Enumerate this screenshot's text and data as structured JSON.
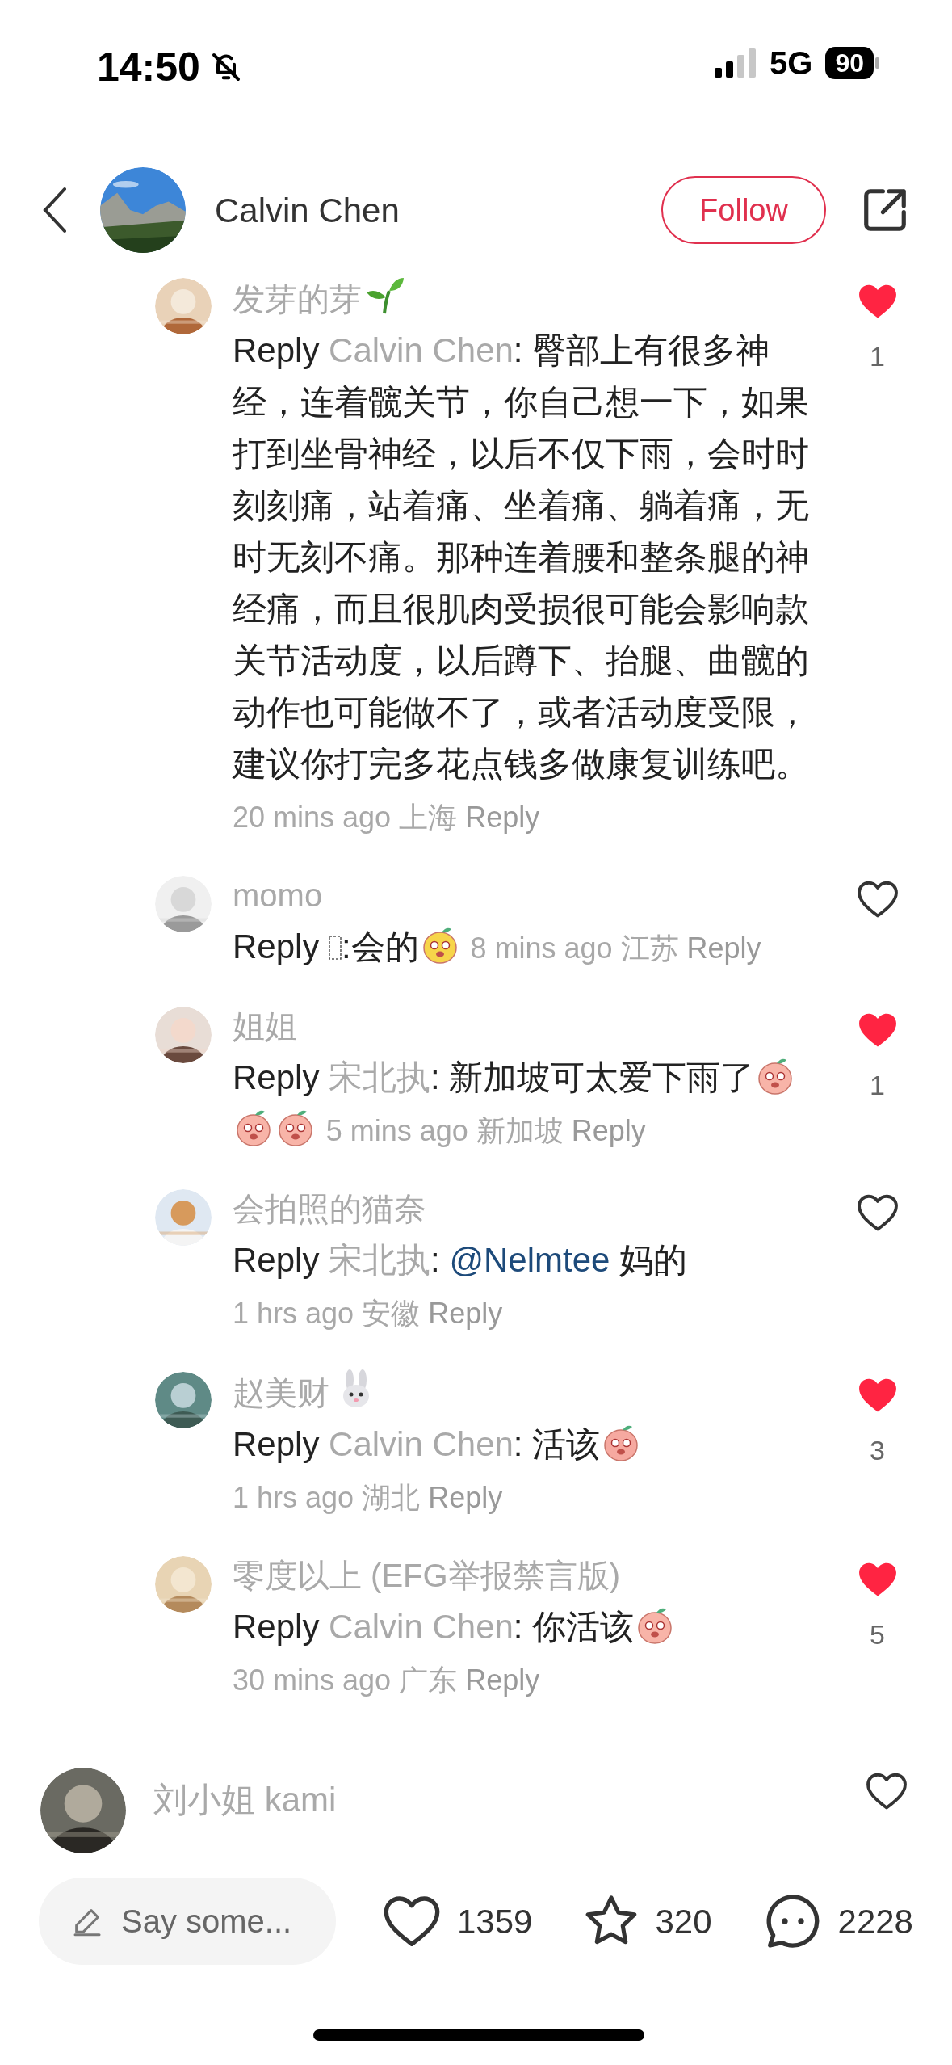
{
  "status_bar": {
    "time": "14:50",
    "network": "5G",
    "battery": "90"
  },
  "header": {
    "author": "Calvin Chen",
    "follow_label": "Follow"
  },
  "comments": [
    {
      "name": "发芽的芽",
      "name_icon": {
        "kind": "sprout"
      },
      "reply_prefix": "Reply",
      "reply_to": "Calvin Chen",
      "body": ": 臀部上有很多神经，连着髋关节，你自己想一下，如果打到坐骨神经，以后不仅下雨，会时时刻刻痛，站着痛、坐着痛、躺着痛，无时无刻不痛。那种连着腰和整条腿的神经痛，而且很肌肉受损很可能会影响款关节活动度，以后蹲下、抬腿、曲髋的动作也可能做不了，或者活动度受限，建议你打完多花点钱多做康复训练吧。",
      "time": "20 mins ago",
      "location": "上海",
      "reply_label": "Reply",
      "liked": true,
      "likes": "1"
    },
    {
      "name": "momo",
      "reply_prefix": "Reply",
      "missing_glyph": true,
      "body": ":会的",
      "stickers": [
        {
          "kind": "chick"
        }
      ],
      "time": "8 mins ago",
      "location": "江苏",
      "reply_label": "Reply",
      "liked": false
    },
    {
      "name": "姐姐",
      "reply_prefix": "Reply",
      "reply_to": "宋北执",
      "body": ": 新加坡可太爱下雨了",
      "stickers": [
        {
          "kind": "peach"
        },
        {
          "kind": "peach"
        },
        {
          "kind": "peach"
        }
      ],
      "time": "5 mins ago",
      "location": "新加坡",
      "reply_label": "Reply",
      "liked": true,
      "likes": "1"
    },
    {
      "name": "会拍照的猫奈",
      "reply_prefix": "Reply",
      "reply_to": "宋北执",
      "separator": ": ",
      "mention": "@Nelmtee",
      "body": " 妈的",
      "time": "1 hrs ago",
      "location": "安徽",
      "reply_label": "Reply",
      "liked": false
    },
    {
      "name": "赵美财",
      "name_icon": {
        "kind": "rabbit"
      },
      "reply_prefix": "Reply",
      "reply_to": "Calvin Chen",
      "body": ": 活该",
      "stickers": [
        {
          "kind": "laugh"
        }
      ],
      "time": "1 hrs ago",
      "location": "湖北",
      "reply_label": "Reply",
      "liked": true,
      "likes": "3"
    },
    {
      "name": "零度以上 (EFG举报禁言版)",
      "reply_prefix": "Reply",
      "reply_to": "Calvin Chen",
      "body": ": 你活该",
      "stickers": [
        {
          "kind": "peach"
        }
      ],
      "time": "30 mins ago",
      "location": "广东",
      "reply_label": "Reply",
      "liked": true,
      "likes": "5"
    }
  ],
  "top_comment": {
    "name": "刘小姐 kami",
    "liked": false
  },
  "bottom_bar": {
    "placeholder": "Say some...",
    "likes": "1359",
    "stars": "320",
    "comments": "2228"
  }
}
